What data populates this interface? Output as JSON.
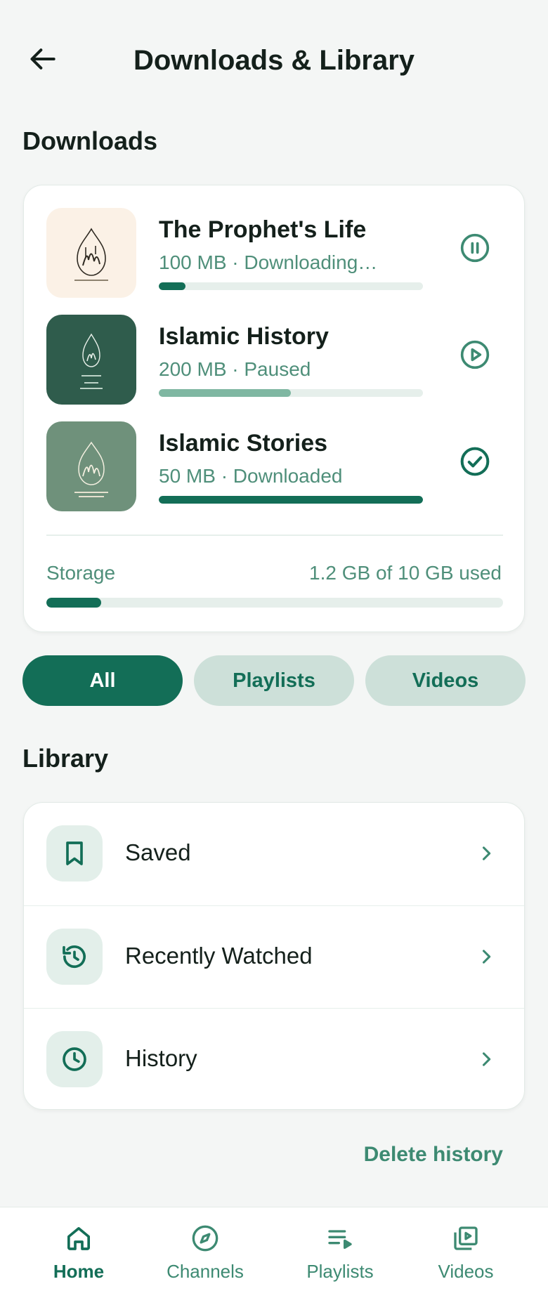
{
  "header": {
    "title": "Downloads & Library",
    "back_icon": "arrow-left-icon"
  },
  "downloads": {
    "section_title": "Downloads",
    "items": [
      {
        "title": "The Prophet's Life",
        "meta": "100 MB · Downloading…",
        "progress": 0.1,
        "status": "downloading",
        "action_icon": "pause-circle-icon",
        "thumb_bg": "#fbf1e6",
        "thumb_fg": "#2f2a22"
      },
      {
        "title": "Islamic History",
        "meta": "200 MB · Paused",
        "progress": 0.5,
        "status": "paused",
        "action_icon": "play-circle-icon",
        "thumb_bg": "#2f5c4c",
        "thumb_fg": "#e8efe9"
      },
      {
        "title": "Islamic Stories",
        "meta": "50 MB · Downloaded",
        "progress": 1.0,
        "status": "downloaded",
        "action_icon": "check-circle-icon",
        "thumb_bg": "#6f917b",
        "thumb_fg": "#f3efe0"
      }
    ],
    "storage": {
      "label": "Storage",
      "value": "1.2 GB of 10 GB used",
      "fraction": 0.12
    }
  },
  "filters": {
    "chips": [
      {
        "label": "All",
        "active": true
      },
      {
        "label": "Playlists",
        "active": false
      },
      {
        "label": "Videos",
        "active": false
      }
    ]
  },
  "library": {
    "section_title": "Library",
    "items": [
      {
        "label": "Saved",
        "icon": "bookmark-icon"
      },
      {
        "label": "Recently Watched",
        "icon": "history-icon"
      },
      {
        "label": "History",
        "icon": "clock-icon"
      }
    ],
    "delete_label": "Delete history"
  },
  "nav": {
    "items": [
      {
        "label": "Home",
        "icon": "home-icon",
        "active": true
      },
      {
        "label": "Channels",
        "icon": "compass-icon",
        "active": false
      },
      {
        "label": "Playlists",
        "icon": "playlist-icon",
        "active": false
      },
      {
        "label": "Videos",
        "icon": "video-library-icon",
        "active": false
      }
    ]
  },
  "colors": {
    "accent": "#136e57",
    "accent_light": "#cde0d9",
    "muted_text": "#4f8f7a",
    "paused_progress": "#7fb7a2",
    "track": "#e6efeb"
  }
}
